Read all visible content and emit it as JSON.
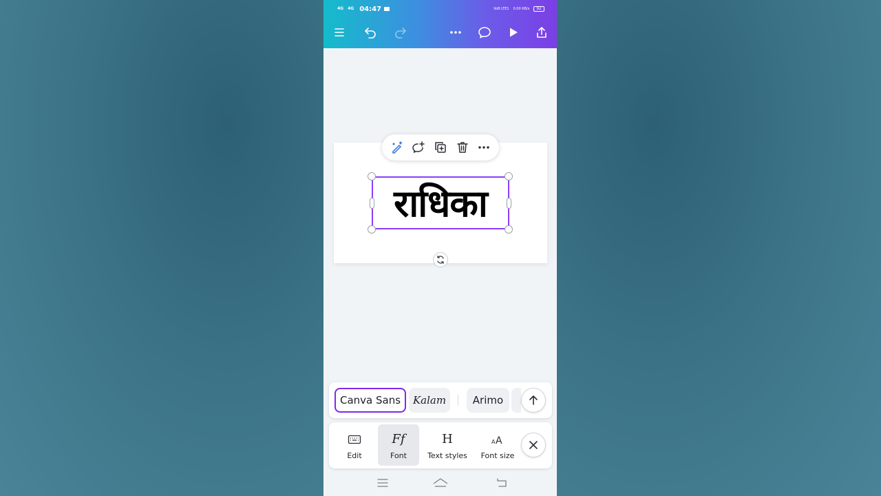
{
  "status_bar": {
    "network_1": "4G",
    "network_2": "4G",
    "time": "04:47",
    "volte": "VoB LTE1",
    "speed": "0.00 KB/s",
    "battery": "92"
  },
  "toolbar": {
    "menu_icon": "hamburger-icon",
    "undo_icon": "undo-icon",
    "redo_icon": "redo-icon",
    "more_icon": "more-icon",
    "comment_icon": "comment-icon",
    "play_icon": "play-icon",
    "share_icon": "share-icon"
  },
  "canvas": {
    "text": "राधिका"
  },
  "floating_menu": {
    "items": [
      "magic-edit-icon",
      "add-comment-icon",
      "duplicate-icon",
      "delete-icon",
      "more-icon"
    ]
  },
  "font_strip": {
    "fonts": [
      {
        "label": "Canva Sans",
        "selected": true
      },
      {
        "label": "Kalam",
        "selected": false
      },
      {
        "label": "Arimo",
        "selected": false
      }
    ]
  },
  "bottom_toolbar": {
    "items": [
      {
        "label": "Edit",
        "icon": "keyboard-icon",
        "active": false
      },
      {
        "label": "Font",
        "icon": "font-icon",
        "active": true
      },
      {
        "label": "Text styles",
        "icon": "text-styles-icon",
        "active": false
      },
      {
        "label": "Font size",
        "icon": "font-size-icon",
        "active": false
      }
    ]
  },
  "colors": {
    "accent": "#8b3dff",
    "topbar_start": "#14bccb",
    "topbar_end": "#7b3fe6"
  }
}
